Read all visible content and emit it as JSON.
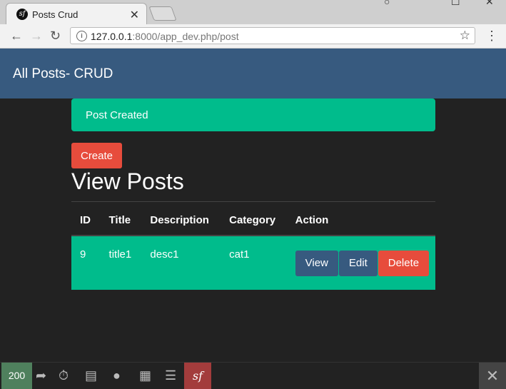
{
  "browser": {
    "tab_title": "Posts Crud",
    "tab_close": "✕",
    "url_host": "127.0.0.1",
    "url_rest": ":8000/app_dev.php/post"
  },
  "page": {
    "brand": "All Posts- CRUD",
    "alert": "Post Created",
    "create_label": "Create",
    "heading": "View Posts",
    "table": {
      "headers": [
        "ID",
        "Title",
        "Description",
        "Category",
        "Action"
      ],
      "rows": [
        {
          "id": "9",
          "title": "title1",
          "description": "desc1",
          "category": "cat1",
          "actions": [
            "View",
            "Edit",
            "Delete"
          ]
        }
      ]
    }
  },
  "debug_toolbar": {
    "status_code": "200"
  },
  "colors": {
    "navbar": "#375a7f",
    "success": "#00bc8c",
    "danger": "#e74c3c",
    "background": "#222222"
  },
  "icons": [
    "back-icon",
    "forward-icon",
    "reload-icon",
    "info-icon",
    "bookmark-star-icon",
    "menu-icon",
    "ajax-icon",
    "timer-icon",
    "memory-icon",
    "user-icon",
    "template-icon",
    "database-icon",
    "symfony-logo-icon",
    "close-icon"
  ]
}
